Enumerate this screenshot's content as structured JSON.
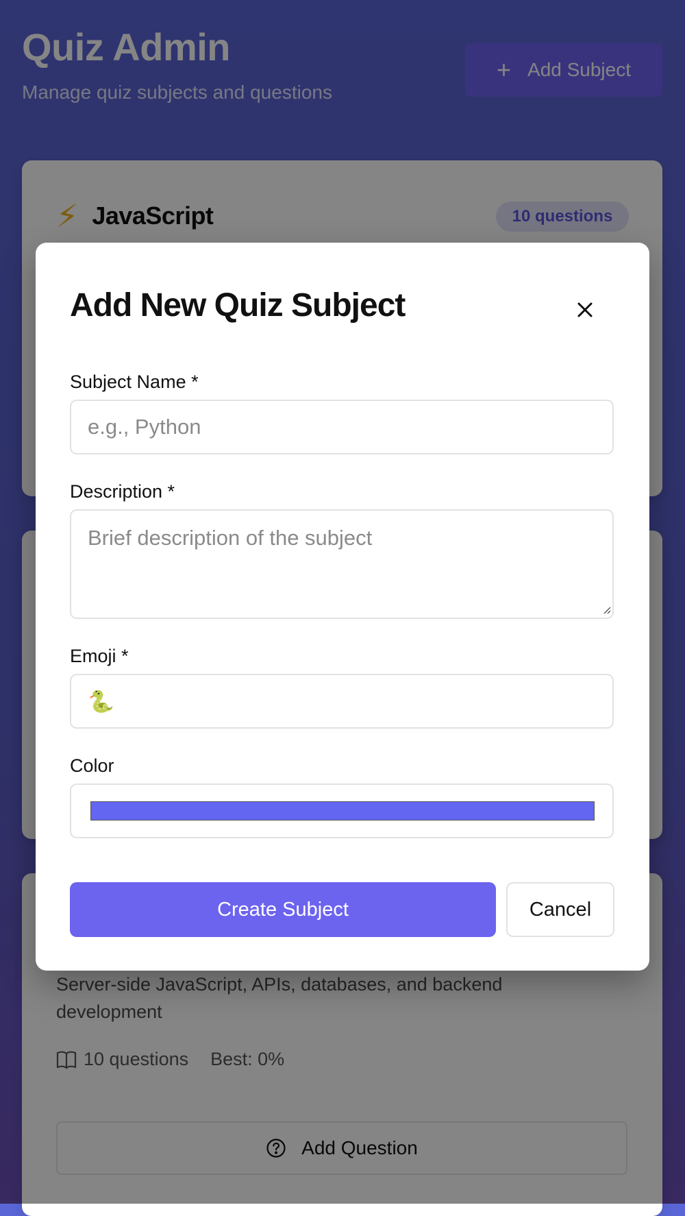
{
  "header": {
    "title": "Quiz Admin",
    "subtitle": "Manage quiz subjects and questions",
    "add_subject_label": "Add Subject",
    "add_subject_icon": "plus-icon"
  },
  "subjects": [
    {
      "emoji": "⚡",
      "name": "JavaScript",
      "badge": "10 questions"
    },
    {
      "description": "Server-side JavaScript, APIs, databases, and backend development",
      "questions": "10 questions",
      "best": "Best: 0%",
      "add_question_label": "Add Question"
    }
  ],
  "modal": {
    "title": "Add New Quiz Subject",
    "close_icon": "close-icon",
    "name_label": "Subject Name *",
    "name_placeholder": "e.g., Python",
    "name_value": "",
    "description_label": "Description *",
    "description_placeholder": "Brief description of the subject",
    "description_value": "",
    "emoji_label": "Emoji *",
    "emoji_value": "🐍",
    "color_label": "Color",
    "color_value": "#6366f1",
    "create_label": "Create Subject",
    "cancel_label": "Cancel"
  },
  "colors": {
    "accent": "#6c63ef",
    "badge_bg": "#e2e3fb",
    "badge_text": "#5a55d8"
  }
}
